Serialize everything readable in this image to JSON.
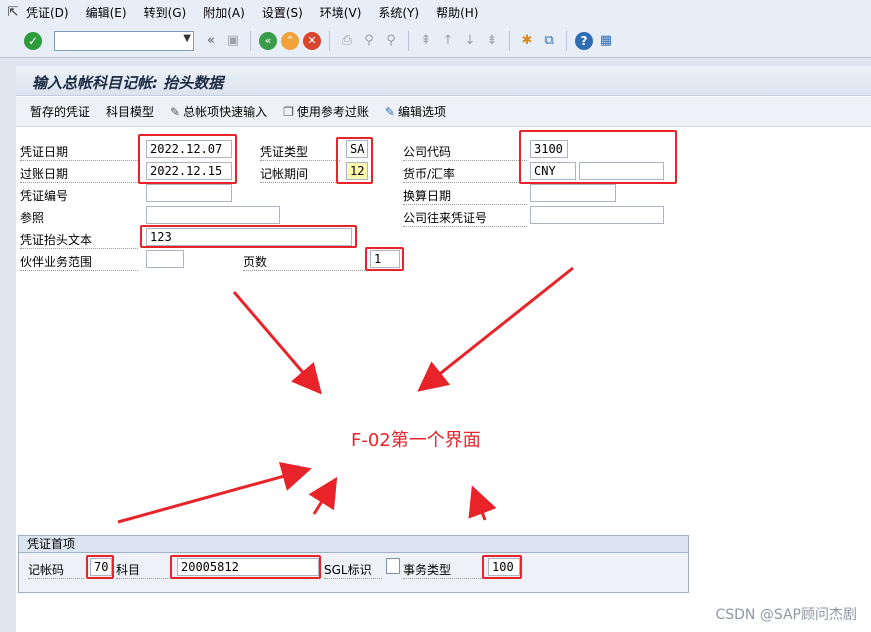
{
  "menubar": {
    "items": [
      "凭证(D)",
      "编辑(E)",
      "转到(G)",
      "附加(A)",
      "设置(S)",
      "环境(V)",
      "系统(Y)",
      "帮助(H)"
    ]
  },
  "toolbar": {
    "command_value": "",
    "icons": [
      "enter-icon",
      "save-icon",
      "back-icon",
      "exit-icon",
      "cancel-icon",
      "print-icon",
      "find-icon",
      "find-next-icon",
      "first-page-icon",
      "prev-page-icon",
      "next-page-icon",
      "last-page-icon",
      "new-session-icon",
      "shortcut-icon",
      "help-icon",
      "layout-icon"
    ]
  },
  "screen": {
    "title": "输入总帐科目记帐: 抬头数据"
  },
  "app_toolbar": {
    "held_doc": "暂存的凭证",
    "acct_model": "科目模型",
    "fast_entry": "总帐项快速输入",
    "post_with_ref": "使用参考过账",
    "edit_options": "编辑选项"
  },
  "header": {
    "doc_date_label": "凭证日期",
    "doc_date": "2022.12.07",
    "posting_date_label": "过账日期",
    "posting_date": "2022.12.15",
    "doc_number_label": "凭证编号",
    "doc_number": "",
    "reference_label": "参照",
    "reference": "",
    "header_text_label": "凭证抬头文本",
    "header_text": "123",
    "trading_partner_label": "伙伴业务范围",
    "trading_partner": "",
    "doc_type_label": "凭证类型",
    "doc_type": "SA",
    "period_label": "记帐期间",
    "period": "12",
    "pages_label": "页数",
    "pages": "1",
    "company_code_label": "公司代码",
    "company_code": "3100",
    "currency_label": "货币/汇率",
    "currency": "CNY",
    "exchange_rate": "",
    "translation_date_label": "换算日期",
    "translation_date": "",
    "intercompany_label": "公司往来凭证号",
    "intercompany": ""
  },
  "annotation": {
    "caption": "F-02第一个界面",
    "color": "#e8242a"
  },
  "first_item": {
    "group_title": "凭证首项",
    "posting_key_label": "记帐码",
    "posting_key": "70",
    "account_label": "科目",
    "account": "20005812",
    "sgl_label": "SGL标识",
    "sgl_value": "",
    "trans_type_label": "事务类型",
    "trans_type": "100"
  },
  "watermark": "CSDN @SAP顾问杰剧"
}
